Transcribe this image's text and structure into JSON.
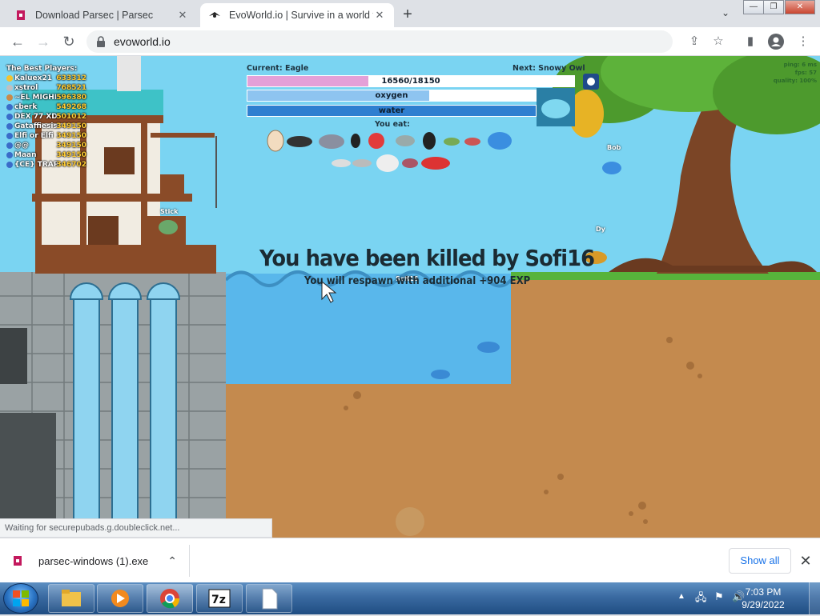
{
  "browser": {
    "tabs": [
      {
        "title": "Download Parsec | Parsec",
        "favicon": "parsec-icon",
        "active": false
      },
      {
        "title": "EvoWorld.io | Survive in a world full of",
        "favicon": "evoworld-icon",
        "active": true
      }
    ],
    "address": "evoworld.io",
    "status_bar": "Waiting for securepubads.g.doubleclick.net..."
  },
  "game": {
    "current_label": "Current: Eagle",
    "next_label": "Next: Snowy Owl",
    "xp_text": "16560/18150",
    "xp_fraction": 0.37,
    "oxygen_label": "oxygen",
    "oxygen_fraction": 0.63,
    "water_label": "water",
    "water_fraction": 1.0,
    "you_eat_label": "You eat:",
    "killed_text": "You have been killed by Sofi16",
    "respawn_text": "You will respawn with additional +904 EXP",
    "stats": {
      "ping": "ping: 6 ms",
      "fps": "fps: 57",
      "quality": "quality: 100%"
    },
    "leaderboard": {
      "title": "The Best Players:",
      "rows": [
        {
          "name": "Kaluex21",
          "score": "633312"
        },
        {
          "name": "xstrol",
          "score": "768521"
        },
        {
          "name": "~EL MIGHI~",
          "score": "596380"
        },
        {
          "name": "cberk",
          "score": "549268"
        },
        {
          "name": "DEX 77 XD",
          "score": "501012"
        },
        {
          "name": "Gataffiesis",
          "score": "349150"
        },
        {
          "name": "Elfi or Elfi",
          "score": "349150"
        },
        {
          "name": "@@",
          "score": "349150"
        },
        {
          "name": "Maan",
          "score": "349150"
        },
        {
          "name": "{CE} TRAP",
          "score": "346702"
        }
      ]
    },
    "player_tags": [
      {
        "name": "Stick"
      },
      {
        "name": "Bob"
      },
      {
        "name": "Dy"
      },
      {
        "name": "Sofi16"
      }
    ]
  },
  "downloads": {
    "file": "parsec-windows (1).exe",
    "show_all": "Show all"
  },
  "taskbar": {
    "time": "7:03 PM",
    "date": "9/29/2022",
    "apps": [
      "windows-explorer",
      "media-player",
      "chrome",
      "7zip",
      "blank-document"
    ]
  }
}
